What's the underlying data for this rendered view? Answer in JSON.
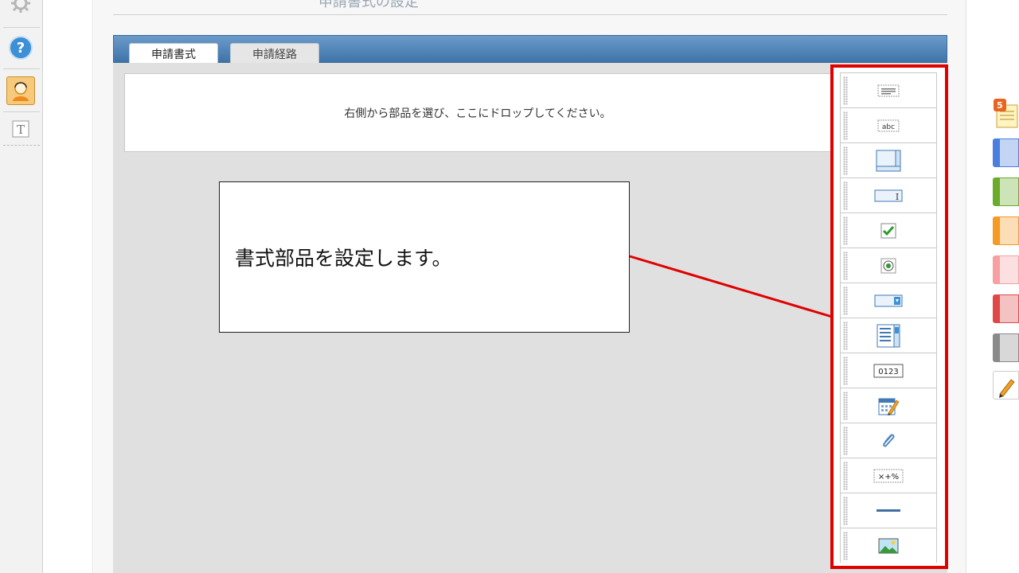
{
  "header": {
    "title": "申請書式の設定"
  },
  "tabs": [
    {
      "label": "申請書式",
      "active": true
    },
    {
      "label": "申請経路",
      "active": false
    }
  ],
  "drop_zone": {
    "text": "右側から部品を選び、ここにドロップしてください。"
  },
  "callout": {
    "text": "書式部品を設定します。"
  },
  "palette": {
    "parts": [
      {
        "icon": "label-text-icon"
      },
      {
        "icon": "text-abc-icon"
      },
      {
        "icon": "textarea-icon"
      },
      {
        "icon": "text-input-icon"
      },
      {
        "icon": "checkbox-icon"
      },
      {
        "icon": "radio-button-icon"
      },
      {
        "icon": "dropdown-icon"
      },
      {
        "icon": "list-box-icon"
      },
      {
        "icon": "number-icon",
        "text": "0123"
      },
      {
        "icon": "date-calendar-icon"
      },
      {
        "icon": "attachment-clip-icon"
      },
      {
        "icon": "calculation-icon",
        "text": "×+%"
      },
      {
        "icon": "separator-line-icon"
      },
      {
        "icon": "image-icon"
      }
    ]
  },
  "left_rail": {
    "icons": [
      "gear-icon",
      "help-icon",
      "support-avatar-icon",
      "text-format-icon"
    ],
    "help_glyph": "?",
    "text_glyph": "T"
  },
  "right_strip": {
    "badge": "5",
    "colors": [
      "#4a7fe0",
      "#6aab2a",
      "#f59a23",
      "#f7a0a4",
      "#e04848",
      "#8a8a8a"
    ]
  },
  "colors": {
    "accent_red": "#e00000",
    "tab_blue": "#4f84b8"
  }
}
